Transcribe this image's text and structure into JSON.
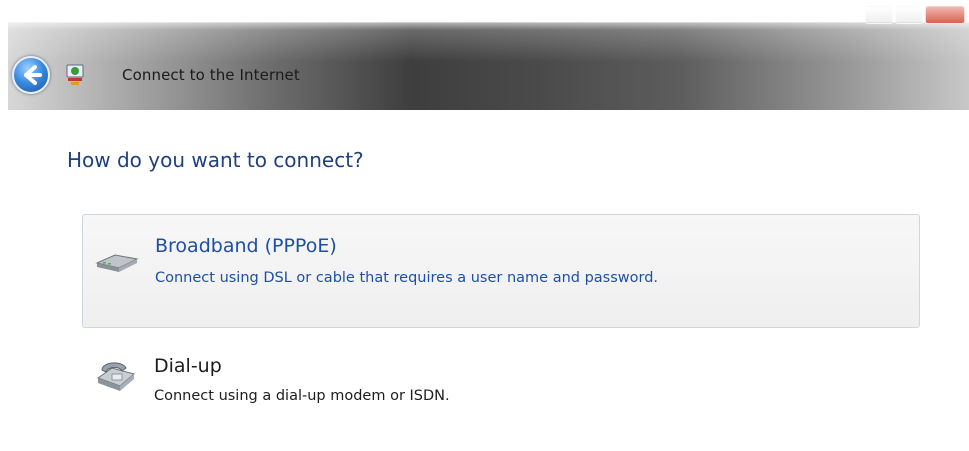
{
  "window": {
    "title": "Connect to the Internet"
  },
  "main": {
    "question": "How do you want to connect?",
    "options": [
      {
        "title": "Broadband (PPPoE)",
        "description": "Connect using DSL or cable that requires a user name and password.",
        "icon": "broadband-modem-icon",
        "selected": true
      },
      {
        "title": "Dial-up",
        "description": "Connect using a dial-up modem or ISDN.",
        "icon": "dialup-phone-icon",
        "selected": false
      }
    ]
  },
  "colors": {
    "accent_text": "#1e4fa6",
    "question_text": "#1f3f7f",
    "selected_background": "#f2f2f2"
  }
}
